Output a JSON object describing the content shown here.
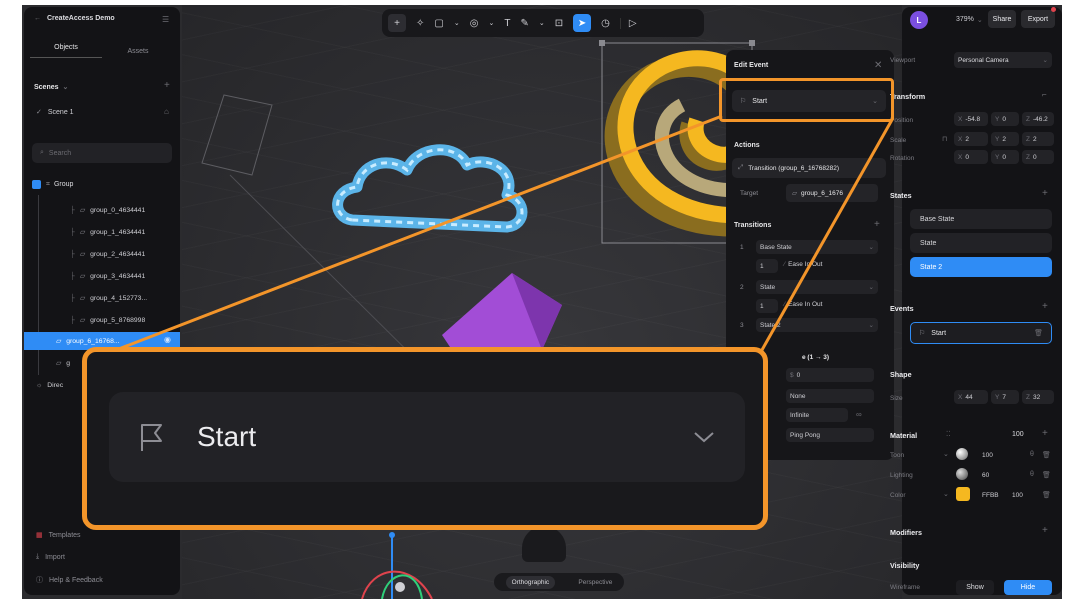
{
  "app": {
    "title": "CreateAccess Demo"
  },
  "left": {
    "tabs": [
      "Objects",
      "Assets"
    ],
    "scenes_label": "Scenes",
    "scene_name": "Scene 1",
    "search_placeholder": "Search",
    "group_label": "Group",
    "items": [
      "group_0_4634441",
      "group_1_4634441",
      "group_2_4634441",
      "group_3_4634441",
      "group_4_152773...",
      "group_5_8768998",
      "group_6_16768..."
    ],
    "item_partial": "g",
    "direct_partial": "Direc",
    "bottom": [
      "Templates",
      "Import",
      "Help & Feedback"
    ]
  },
  "toolbar": {
    "tools": [
      "plus",
      "magic",
      "square",
      "chevron",
      "sphere",
      "chevron",
      "text",
      "pen",
      "chevron",
      "frame",
      "select",
      "timer",
      "play"
    ]
  },
  "canvas": {
    "views": [
      "Orthographic",
      "Perspective"
    ],
    "active_view": "Orthographic"
  },
  "edit_event": {
    "title": "Edit Event",
    "trigger": "Start",
    "actions_label": "Actions",
    "action_name": "Transition (group_6_16768282)",
    "target_label": "Target",
    "target_value": "group_6_1676",
    "transitions_label": "Transitions",
    "transitions": [
      {
        "num": "1",
        "state": "Base State",
        "dur": "1",
        "ease": "Ease In Out"
      },
      {
        "num": "2",
        "state": "State",
        "dur": "1",
        "ease": "Ease In Out"
      },
      {
        "num": "3",
        "state": "State 2"
      }
    ],
    "range_label": "e (1 → 3)",
    "delay": "0",
    "loop1": "None",
    "loop2": "Infinite",
    "inf": "∞",
    "loop3": "Ping Pong"
  },
  "zoom": {
    "trigger": "Start"
  },
  "right": {
    "avatar_letter": "L",
    "zoom": "379%",
    "share": "Share",
    "export": "Export",
    "viewport_label": "Viewport",
    "viewport_value": "Personal Camera",
    "transform_label": "Transform",
    "position_label": "Position",
    "pos": {
      "x": "-54.8",
      "y": "0",
      "z": "-46.2"
    },
    "scale_label": "Scale",
    "scale": {
      "x": "2",
      "y": "2",
      "z": "2"
    },
    "rotation_label": "Rotation",
    "rot": {
      "x": "0",
      "y": "0",
      "z": "0"
    },
    "states_label": "States",
    "states": [
      "Base State",
      "State",
      "State 2"
    ],
    "events_label": "Events",
    "event": "Start",
    "shape_label": "Shape",
    "size_label": "Size",
    "size": {
      "x": "44",
      "y": "7",
      "z": "32"
    },
    "material_label": "Material",
    "material_value": "100",
    "toon_label": "Toon",
    "toon_value": "100",
    "lighting_label": "Lighting",
    "lighting_value": "60",
    "color_label": "Color",
    "color_hex": "FFBB",
    "color_opacity": "100",
    "modifiers_label": "Modifiers",
    "visibility_label": "Visibility",
    "wireframe_label": "Wireframe",
    "show": "Show",
    "hide": "Hide"
  },
  "colors": {
    "accent": "#2f8cf5",
    "highlight": "#f3952a",
    "gold": "#f5b820",
    "cloud": "#5bb4e8",
    "purple": "#a24dd6"
  },
  "axes": {
    "x": "X",
    "y": "Y",
    "z": "Z"
  }
}
